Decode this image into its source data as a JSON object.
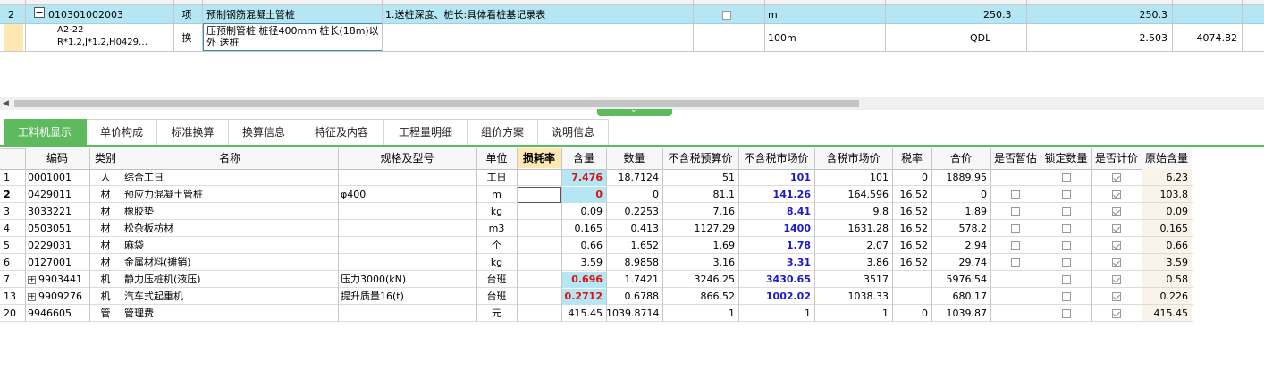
{
  "top_grid": {
    "row_main": {
      "num": "2",
      "code": "010301002003",
      "type": "项",
      "name": "预制钢筋混凝土管桩",
      "feature": "1.送桩深度、桩长:具体看桩基记录表",
      "unit": "m",
      "qty_expr": "250.3",
      "qty": "250.3"
    },
    "row_sub": {
      "code_line1": "A2-22",
      "code_line2": "R*1.2,J*1.2,H0429…",
      "type": "换",
      "name": "压预制管桩 桩径400mm 桩长(18m)以外 送桩",
      "unit": "100m",
      "qty_expr": "QDL",
      "qty": "2.503",
      "price": "4074.82"
    }
  },
  "tabs": [
    "工料机显示",
    "单价构成",
    "标准换算",
    "换算信息",
    "特征及内容",
    "工程量明细",
    "组价方案",
    "说明信息"
  ],
  "columns": [
    "编码",
    "类别",
    "名称",
    "规格及型号",
    "单位",
    "损耗率",
    "含量",
    "数量",
    "不含税预算价",
    "不含税市场价",
    "含税市场价",
    "税率",
    "合价",
    "是否暂估",
    "锁定数量",
    "是否计价",
    "原始含量"
  ],
  "rows": [
    {
      "num": "1",
      "code": "0001001",
      "cat": "人",
      "name": "综合工日",
      "spec": "",
      "unit": "工日",
      "loss": "",
      "content": "7.476",
      "qty": "18.7124",
      "budget": "51",
      "market": "101",
      "taxed": "101",
      "rate": "0",
      "total": "1889.95",
      "est": false,
      "lock": false,
      "priced": true,
      "orig": "6.23",
      "expand": false
    },
    {
      "num": "2",
      "code": "0429011",
      "cat": "材",
      "name": "预应力混凝土管桩",
      "spec": "φ400",
      "unit": "m",
      "loss": "",
      "content": "0",
      "qty": "0",
      "budget": "81.1",
      "market": "141.26",
      "taxed": "164.596",
      "rate": "16.52",
      "total": "0",
      "est": false,
      "lock": false,
      "priced": true,
      "orig": "103.8",
      "expand": false
    },
    {
      "num": "3",
      "code": "3033221",
      "cat": "材",
      "name": "橡胶垫",
      "spec": "",
      "unit": "kg",
      "loss": "",
      "content": "0.09",
      "qty": "0.2253",
      "budget": "7.16",
      "market": "8.41",
      "taxed": "9.8",
      "rate": "16.52",
      "total": "1.89",
      "est": false,
      "lock": false,
      "priced": true,
      "orig": "0.09",
      "expand": false
    },
    {
      "num": "4",
      "code": "0503051",
      "cat": "材",
      "name": "松杂板枋材",
      "spec": "",
      "unit": "m3",
      "loss": "",
      "content": "0.165",
      "qty": "0.413",
      "budget": "1127.29",
      "market": "1400",
      "taxed": "1631.28",
      "rate": "16.52",
      "total": "578.2",
      "est": false,
      "lock": false,
      "priced": true,
      "orig": "0.165",
      "expand": false
    },
    {
      "num": "5",
      "code": "0229031",
      "cat": "材",
      "name": "麻袋",
      "spec": "",
      "unit": "个",
      "loss": "",
      "content": "0.66",
      "qty": "1.652",
      "budget": "1.69",
      "market": "1.78",
      "taxed": "2.07",
      "rate": "16.52",
      "total": "2.94",
      "est": false,
      "lock": false,
      "priced": true,
      "orig": "0.66",
      "expand": false
    },
    {
      "num": "6",
      "code": "0127001",
      "cat": "材",
      "name": "金属材料(摊销)",
      "spec": "",
      "unit": "kg",
      "loss": "",
      "content": "3.59",
      "qty": "8.9858",
      "budget": "3.16",
      "market": "3.31",
      "taxed": "3.86",
      "rate": "16.52",
      "total": "29.74",
      "est": false,
      "lock": false,
      "priced": true,
      "orig": "3.59",
      "expand": false
    },
    {
      "num": "7",
      "code": "9903441",
      "cat": "机",
      "name": "静力压桩机(液压)",
      "spec": "压力3000(kN)",
      "unit": "台班",
      "loss": "",
      "content": "0.696",
      "qty": "1.7421",
      "budget": "3246.25",
      "market": "3430.65",
      "taxed": "3517",
      "rate": "",
      "total": "5976.54",
      "est": false,
      "lock": false,
      "priced": true,
      "orig": "0.58",
      "expand": true
    },
    {
      "num": "13",
      "code": "9909276",
      "cat": "机",
      "name": "汽车式起重机",
      "spec": "提升质量16(t)",
      "unit": "台班",
      "loss": "",
      "content": "0.2712",
      "qty": "0.6788",
      "budget": "866.52",
      "market": "1002.02",
      "taxed": "1038.33",
      "rate": "",
      "total": "680.17",
      "est": false,
      "lock": false,
      "priced": true,
      "orig": "0.226",
      "expand": true
    },
    {
      "num": "20",
      "code": "9946605",
      "cat": "管",
      "name": "管理费",
      "spec": "",
      "unit": "元",
      "loss": "",
      "content": "415.45",
      "qty": "1039.8714",
      "budget": "1",
      "market": "1",
      "taxed": "1",
      "rate": "0",
      "total": "1039.87",
      "est": false,
      "lock": false,
      "priced": true,
      "orig": "415.45",
      "expand": false
    }
  ],
  "colors": {
    "tab_active": "#5dba5d",
    "row_highlight": "#b4e6f4",
    "header_highlight": "#fce8b0",
    "red": "#e01010",
    "blue": "#1a1ad0"
  }
}
